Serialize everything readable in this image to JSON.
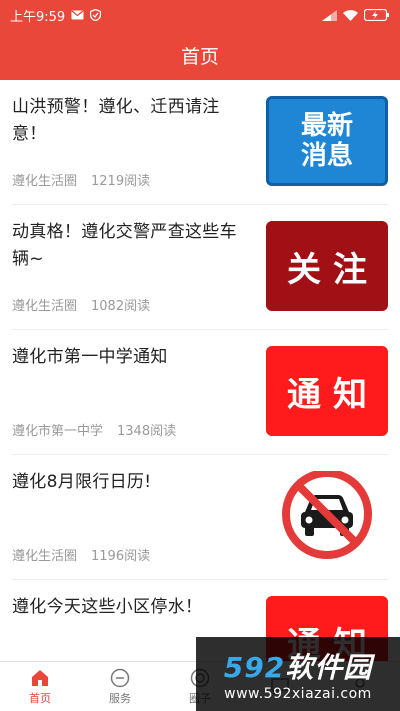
{
  "status_bar": {
    "time": "上午9:59",
    "left_icons": [
      "mail-icon",
      "shield-icon"
    ],
    "right_icons": [
      "signal-icon",
      "wifi-icon",
      "battery-icon"
    ]
  },
  "header": {
    "title": "首页"
  },
  "news": [
    {
      "title": "山洪预警！遵化、迁西请注意！",
      "source": "遵化生活圈",
      "reads": "1219阅读",
      "thumb_text": "最新消息",
      "thumb_color": "#1f86d6"
    },
    {
      "title": "动真格！遵化交警严查这些车辆~",
      "source": "遵化生活圈",
      "reads": "1082阅读",
      "thumb_text": "关注",
      "thumb_color": "#a01014"
    },
    {
      "title": "遵化市第一中学通知",
      "source": "遵化市第一中学",
      "reads": "1348阅读",
      "thumb_text": "通知",
      "thumb_color": "#ff1b1b"
    },
    {
      "title": "遵化8月限行日历!",
      "source": "遵化生活圈",
      "reads": "1196阅读",
      "thumb_icon": "no-cars-sign-icon"
    },
    {
      "title": "遵化今天这些小区停水！",
      "thumb_text": "通知",
      "thumb_color": "#ff1b1b"
    }
  ],
  "tabs": [
    {
      "label": "首页",
      "icon": "home-icon",
      "active": true
    },
    {
      "label": "服务",
      "icon": "service-icon",
      "active": false
    },
    {
      "label": "圈子",
      "icon": "circle-icon",
      "active": false
    },
    {
      "label": "",
      "icon": "message-icon",
      "active": false
    },
    {
      "label": "",
      "icon": "profile-icon",
      "active": false
    }
  ],
  "watermark": {
    "number": "592",
    "brand": "软件园",
    "url": "www.592xiazai.com"
  },
  "colors": {
    "header_bg": "#e8473a",
    "active_tab": "#e8473a"
  }
}
